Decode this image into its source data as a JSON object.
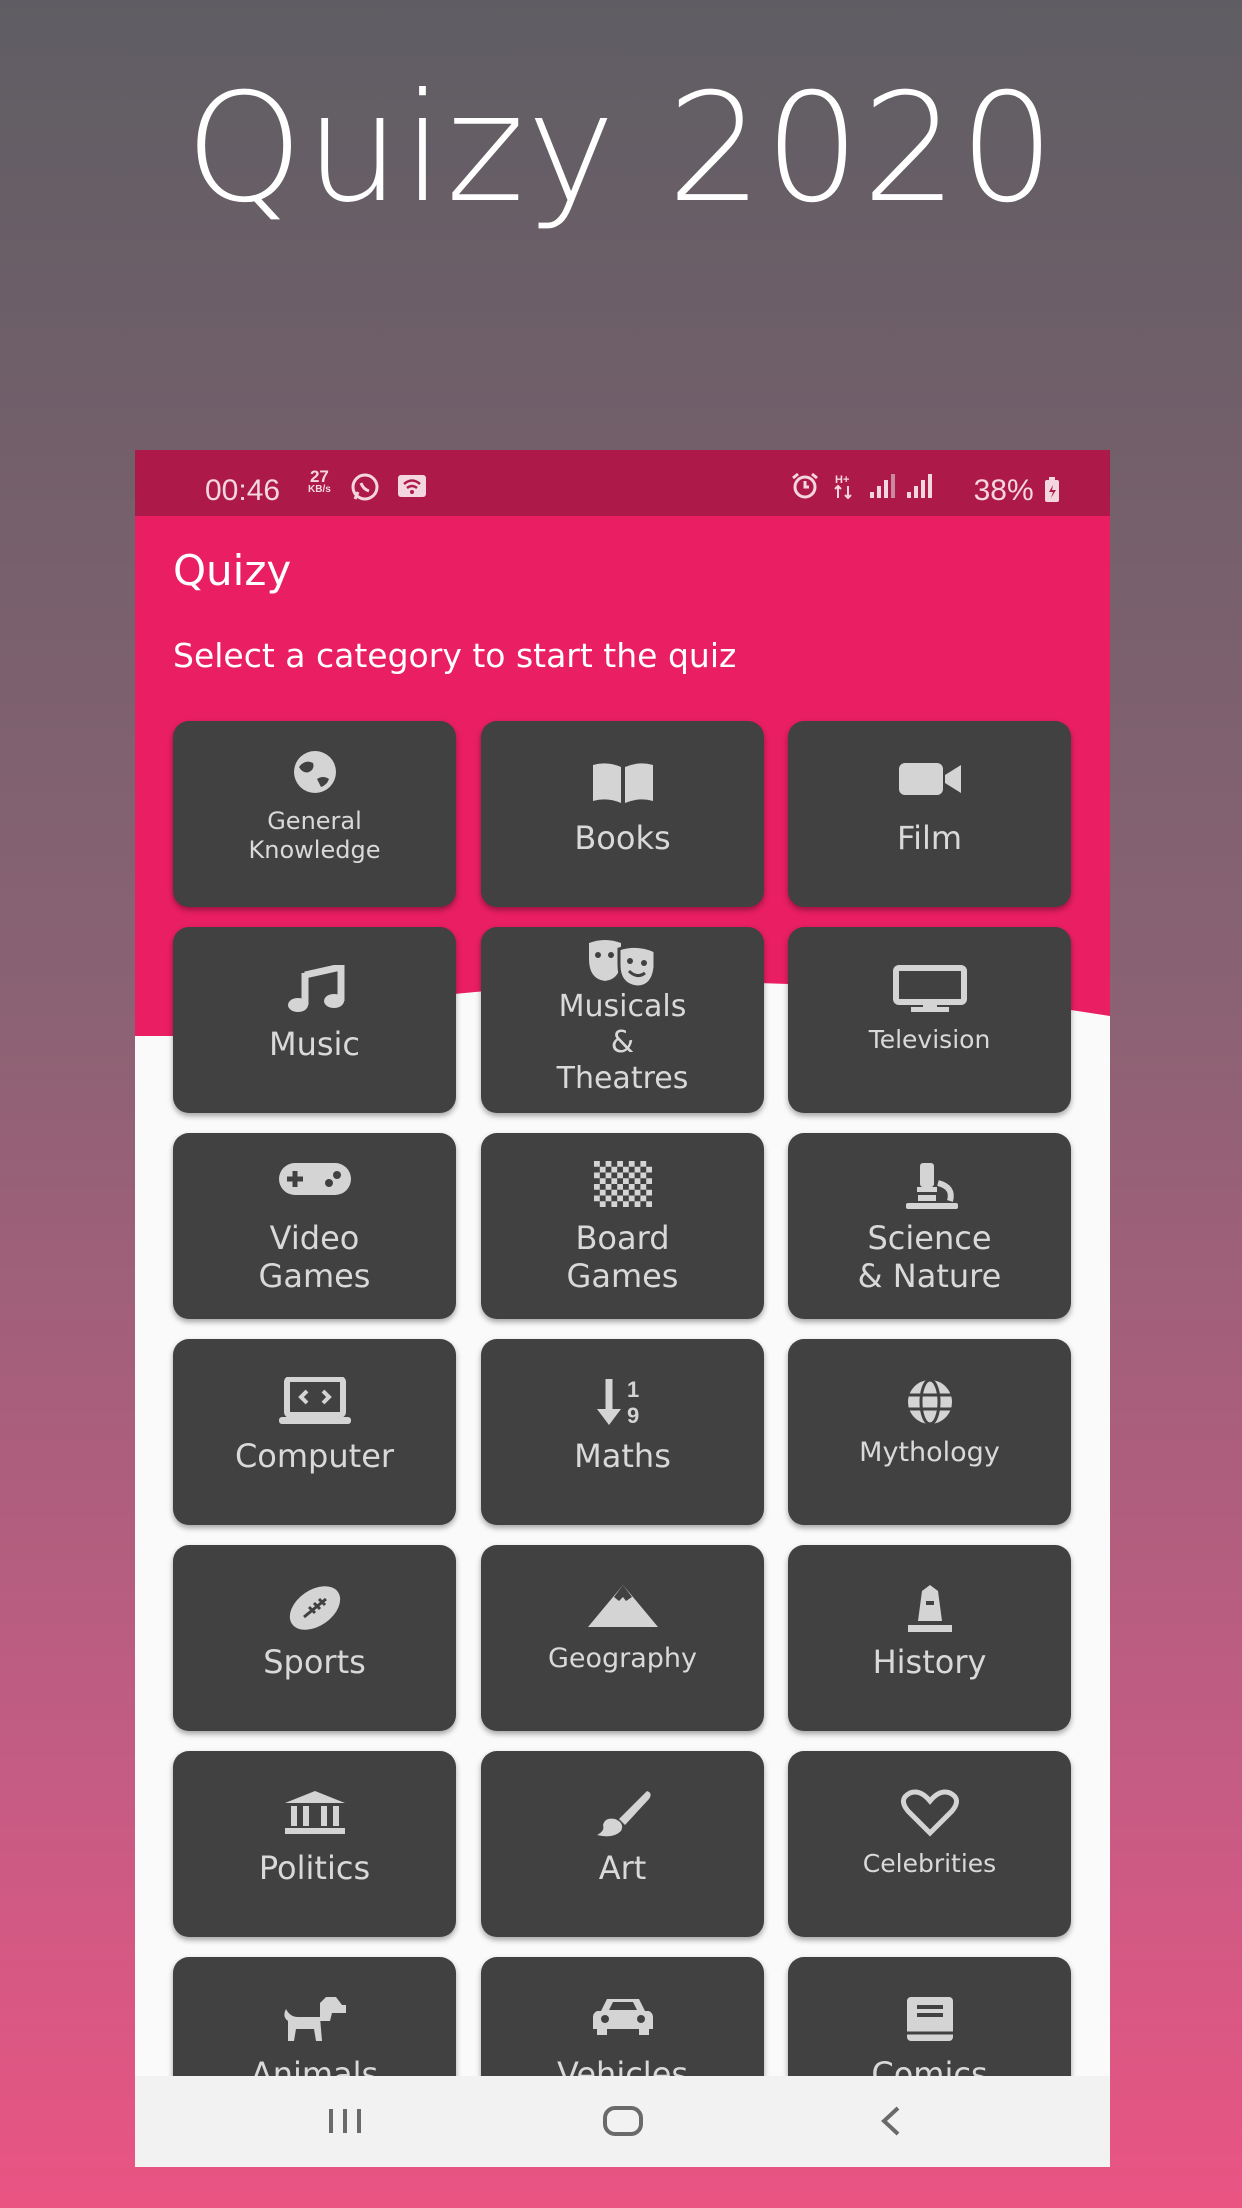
{
  "promo": {
    "title": "Quizy 2020"
  },
  "status_bar": {
    "time": "00:46",
    "speed_value": "27",
    "speed_unit": "KB/s",
    "battery": "38%"
  },
  "app": {
    "title": "Quizy",
    "subtitle": "Select a category to start the quiz"
  },
  "categories": [
    {
      "label": "General\nKnowledge",
      "icon": "globe-icon"
    },
    {
      "label": "Books",
      "icon": "book-open-icon"
    },
    {
      "label": "Film",
      "icon": "video-camera-icon"
    },
    {
      "label": "Music",
      "icon": "music-note-icon"
    },
    {
      "label": "Musicals\n&\nTheatres",
      "icon": "theater-masks-icon"
    },
    {
      "label": "Television",
      "icon": "tv-icon"
    },
    {
      "label": "Video\nGames",
      "icon": "gamepad-icon"
    },
    {
      "label": "Board\nGames",
      "icon": "chessboard-icon"
    },
    {
      "label": "Science\n& Nature",
      "icon": "microscope-icon"
    },
    {
      "label": "Computer",
      "icon": "laptop-code-icon"
    },
    {
      "label": "Maths",
      "icon": "sort-numeric-icon"
    },
    {
      "label": "Mythology",
      "icon": "globe-grid-icon"
    },
    {
      "label": "Sports",
      "icon": "football-icon"
    },
    {
      "label": "Geography",
      "icon": "mountain-icon"
    },
    {
      "label": "History",
      "icon": "monument-icon"
    },
    {
      "label": "Politics",
      "icon": "landmark-icon"
    },
    {
      "label": "Art",
      "icon": "paint-brush-icon"
    },
    {
      "label": "Celebrities",
      "icon": "heart-icon"
    },
    {
      "label": "Animals",
      "icon": "dog-icon"
    },
    {
      "label": "Vehicles",
      "icon": "car-icon"
    },
    {
      "label": "Comics",
      "icon": "book-icon"
    }
  ],
  "colors": {
    "status_bar": "#ad1a4a",
    "header": "#e91e63",
    "card": "#414141",
    "card_text": "#d9d9d9"
  }
}
